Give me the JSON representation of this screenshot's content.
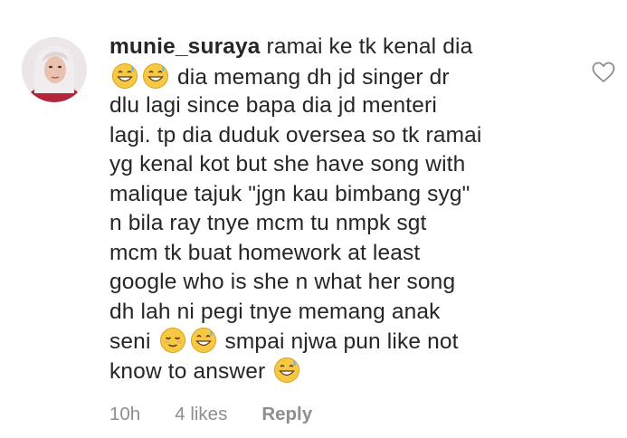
{
  "comment": {
    "username": "munie_suraya",
    "lines": [
      " ramai ke tk kenal dia",
      " dia memang dh jd singer dr",
      "dlu lagi since bapa dia jd menteri",
      "lagi. tp dia duduk oversea so tk ramai",
      "yg kenal kot but she have song with",
      "malique tajuk \"jgn kau bimbang syg\"",
      "n bila ray tnye mcm tu nmpk sgt",
      "mcm tk buat homework at least",
      "google who is she n what her song",
      "dh lah ni pegi tnye memang anak",
      "seni",
      " smpai njwa pun like not",
      "know to answer"
    ],
    "emojis": {
      "line2": [
        "grinning-sweat-emoji",
        "grinning-sweat-emoji"
      ],
      "line11": [
        "relieved-face-emoji",
        "grinning-sweat-emoji"
      ],
      "line12": [
        "grinning-sweat-emoji"
      ]
    },
    "time": "10h",
    "likes": "4 likes",
    "reply_label": "Reply",
    "like_icon": "heart-outline-icon",
    "avatar_icon": "user-avatar"
  },
  "colors": {
    "text": "#262626",
    "meta": "#8e8e8e",
    "icon": "#8e8e8e"
  }
}
